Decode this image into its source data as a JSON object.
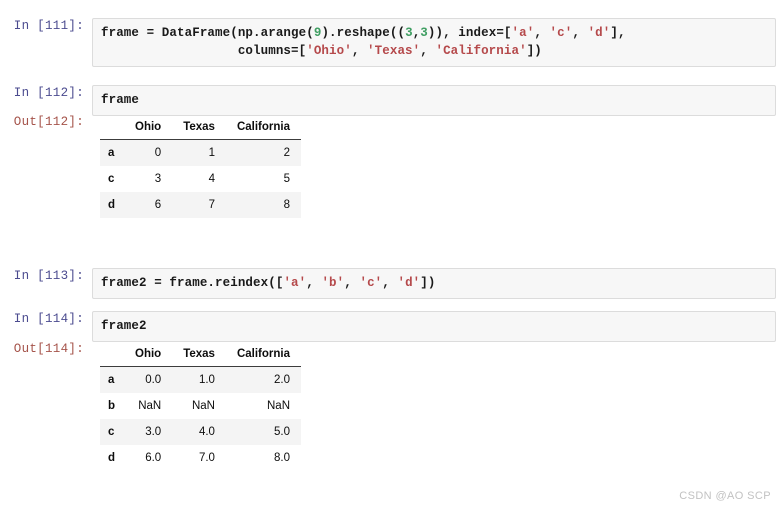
{
  "cells": [
    {
      "prompt": "In [111]:",
      "type": "input",
      "code_lines": [
        [
          {
            "t": "frame = DataFrame(np.arange(",
            "k": "plain"
          },
          {
            "t": "9",
            "k": "num"
          },
          {
            "t": ").reshape((",
            "k": "plain"
          },
          {
            "t": "3",
            "k": "num"
          },
          {
            "t": ",",
            "k": "plain"
          },
          {
            "t": "3",
            "k": "num"
          },
          {
            "t": ")), index=[",
            "k": "plain"
          },
          {
            "t": "'a'",
            "k": "str"
          },
          {
            "t": ", ",
            "k": "plain"
          },
          {
            "t": "'c'",
            "k": "str"
          },
          {
            "t": ", ",
            "k": "plain"
          },
          {
            "t": "'d'",
            "k": "str"
          },
          {
            "t": "],",
            "k": "plain"
          }
        ],
        [
          {
            "t": "                  columns=[",
            "k": "plain"
          },
          {
            "t": "'Ohio'",
            "k": "str"
          },
          {
            "t": ", ",
            "k": "plain"
          },
          {
            "t": "'Texas'",
            "k": "str"
          },
          {
            "t": ", ",
            "k": "plain"
          },
          {
            "t": "'California'",
            "k": "str"
          },
          {
            "t": "])",
            "k": "plain"
          }
        ]
      ]
    },
    {
      "prompt": "In [112]:",
      "type": "input",
      "code_lines": [
        [
          {
            "t": "frame",
            "k": "plain"
          }
        ]
      ]
    },
    {
      "prompt": "Out[112]:",
      "type": "output",
      "table": {
        "index_header": "",
        "columns": [
          "Ohio",
          "Texas",
          "California"
        ],
        "index": [
          "a",
          "c",
          "d"
        ],
        "rows": [
          [
            "0",
            "1",
            "2"
          ],
          [
            "3",
            "4",
            "5"
          ],
          [
            "6",
            "7",
            "8"
          ]
        ]
      }
    },
    {
      "prompt": "In [113]:",
      "type": "input",
      "code_lines": [
        [
          {
            "t": "frame2 = frame.reindex([",
            "k": "plain"
          },
          {
            "t": "'a'",
            "k": "str"
          },
          {
            "t": ", ",
            "k": "plain"
          },
          {
            "t": "'b'",
            "k": "str"
          },
          {
            "t": ", ",
            "k": "plain"
          },
          {
            "t": "'c'",
            "k": "str"
          },
          {
            "t": ", ",
            "k": "plain"
          },
          {
            "t": "'d'",
            "k": "str"
          },
          {
            "t": "])",
            "k": "plain"
          }
        ]
      ]
    },
    {
      "prompt": "In [114]:",
      "type": "input",
      "code_lines": [
        [
          {
            "t": "frame2",
            "k": "plain"
          }
        ]
      ]
    },
    {
      "prompt": "Out[114]:",
      "type": "output",
      "table": {
        "index_header": "",
        "columns": [
          "Ohio",
          "Texas",
          "California"
        ],
        "index": [
          "a",
          "b",
          "c",
          "d"
        ],
        "rows": [
          [
            "0.0",
            "1.0",
            "2.0"
          ],
          [
            "NaN",
            "NaN",
            "NaN"
          ],
          [
            "3.0",
            "4.0",
            "5.0"
          ],
          [
            "6.0",
            "7.0",
            "8.0"
          ]
        ]
      }
    }
  ],
  "watermark": "CSDN @AO SCP",
  "colors": {
    "prompt_in": "#4b4b8f",
    "prompt_out": "#a5534a",
    "string_token": "#b5494b",
    "number_token": "#3f9e62",
    "code_bg": "#f7f7f7",
    "code_border": "#dcdcdc",
    "row_stripe": "#f4f4f4",
    "page_bg": "#ffffff",
    "watermark": "#c2c2c2"
  }
}
